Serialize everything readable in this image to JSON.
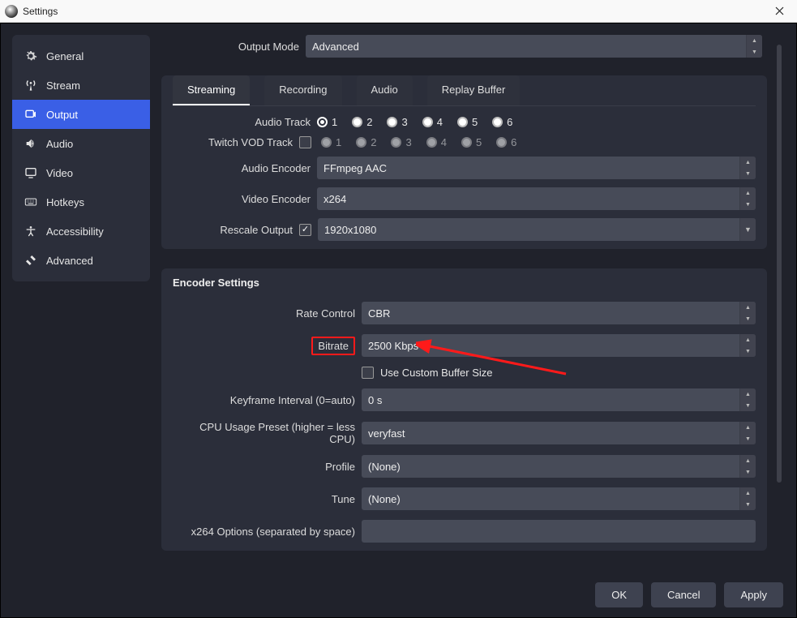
{
  "window": {
    "title": "Settings"
  },
  "sidebar": {
    "items": [
      {
        "label": "General"
      },
      {
        "label": "Stream"
      },
      {
        "label": "Output"
      },
      {
        "label": "Audio"
      },
      {
        "label": "Video"
      },
      {
        "label": "Hotkeys"
      },
      {
        "label": "Accessibility"
      },
      {
        "label": "Advanced"
      }
    ],
    "active_index": 2
  },
  "output": {
    "output_mode_label": "Output Mode",
    "output_mode_value": "Advanced",
    "tabs": [
      {
        "label": "Streaming"
      },
      {
        "label": "Recording"
      },
      {
        "label": "Audio"
      },
      {
        "label": "Replay Buffer"
      }
    ],
    "active_tab": 0,
    "audio_track": {
      "label": "Audio Track",
      "options": [
        "1",
        "2",
        "3",
        "4",
        "5",
        "6"
      ],
      "selected": 0
    },
    "twitch_vod": {
      "label": "Twitch VOD Track",
      "enabled": false,
      "options": [
        "1",
        "2",
        "3",
        "4",
        "5",
        "6"
      ],
      "selected": 0
    },
    "audio_encoder": {
      "label": "Audio Encoder",
      "value": "FFmpeg AAC"
    },
    "video_encoder": {
      "label": "Video Encoder",
      "value": "x264"
    },
    "rescale_output": {
      "label": "Rescale Output",
      "enabled": true,
      "value": "1920x1080"
    }
  },
  "encoder": {
    "title": "Encoder Settings",
    "rate_control": {
      "label": "Rate Control",
      "value": "CBR"
    },
    "bitrate": {
      "label": "Bitrate",
      "value": "2500 Kbps"
    },
    "custom_buffer": {
      "label": "Use Custom Buffer Size",
      "enabled": false
    },
    "keyframe": {
      "label": "Keyframe Interval (0=auto)",
      "value": "0 s"
    },
    "cpu_preset": {
      "label": "CPU Usage Preset (higher = less CPU)",
      "value": "veryfast"
    },
    "profile": {
      "label": "Profile",
      "value": "(None)"
    },
    "tune": {
      "label": "Tune",
      "value": "(None)"
    },
    "x264_opts": {
      "label": "x264 Options (separated by space)",
      "value": ""
    }
  },
  "footer": {
    "ok": "OK",
    "cancel": "Cancel",
    "apply": "Apply"
  }
}
